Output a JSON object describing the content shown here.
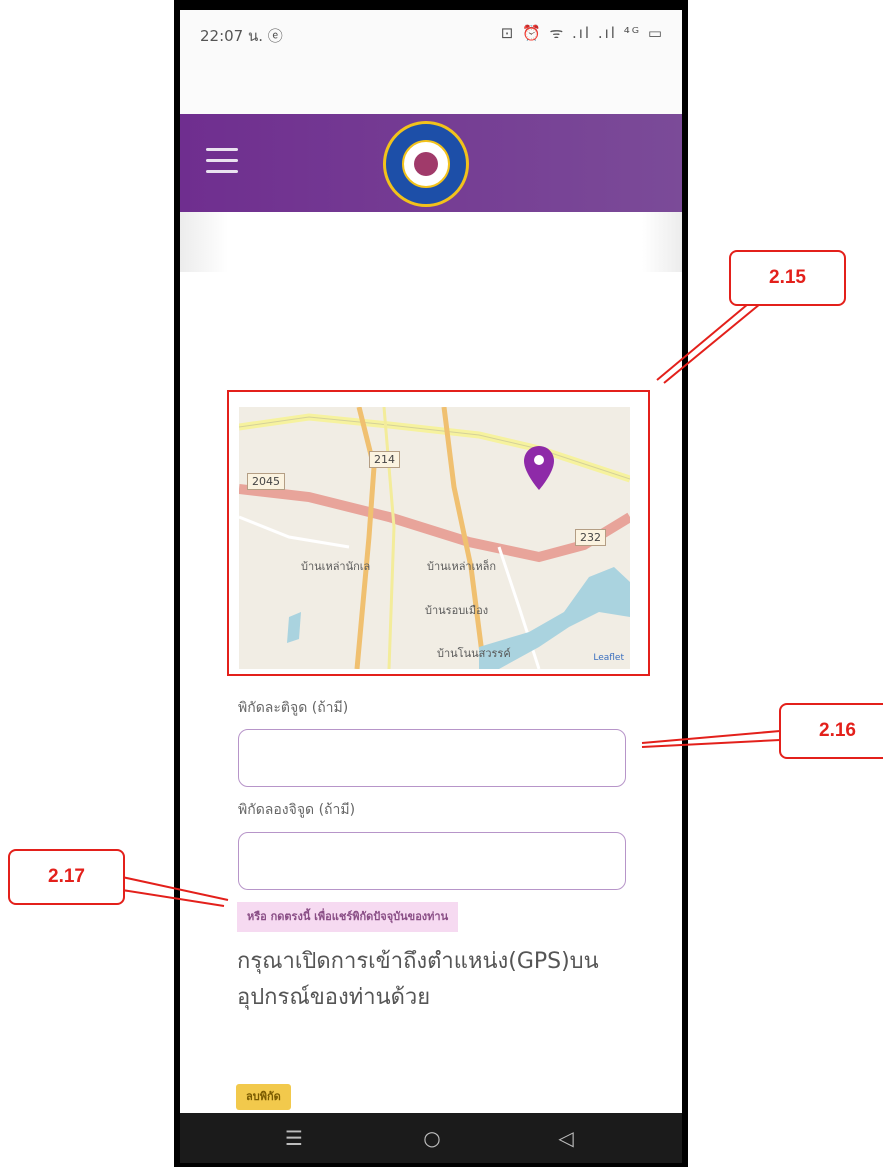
{
  "status_bar": {
    "time": "22:07 น. ⓔ",
    "icons": "⊡ ⏰ ᯤ .ıl .ıl ⁴ᴳ ▭"
  },
  "app_bar": {
    "menu_icon": "hamburger-icon",
    "logo": "municipality-seal-logo"
  },
  "map": {
    "shields": [
      "214",
      "2045",
      "232"
    ],
    "places": [
      "บ้านเหล่านักเล",
      "บ้านเหล่าเหล็ก",
      "บ้านรอบเมือง",
      "บ้านโนนสวรรค์"
    ],
    "attribution": "Leaflet",
    "colors": {
      "primary_road": "#e8a49a",
      "secondary_road": "#f0c070",
      "minor_road": "#f7ef9f",
      "water": "#aad3df",
      "marker": "#8e2aa8"
    }
  },
  "form": {
    "latitude_label": "พิกัดละติจูด (ถ้ามี)",
    "latitude_value": "",
    "longitude_label": "พิกัดลองจิจูด (ถ้ามี)",
    "longitude_value": "",
    "share_location_link": "หรือ กดตรงนี้ เพื่อแชร์พิกัดปัจจุบันของท่าน",
    "gps_note": "กรุณาเปิดการเข้าถึงตำแหน่ง(GPS)บนอุปกรณ์ของท่านด้วย",
    "clear_button": "ลบพิกัด"
  },
  "nav_bar": {
    "recents_icon": "☰",
    "home_icon": "○",
    "back_icon": "◁"
  },
  "annotations": {
    "callouts": [
      "2.15",
      "2.16",
      "2.17"
    ],
    "color": "#e3201b"
  }
}
